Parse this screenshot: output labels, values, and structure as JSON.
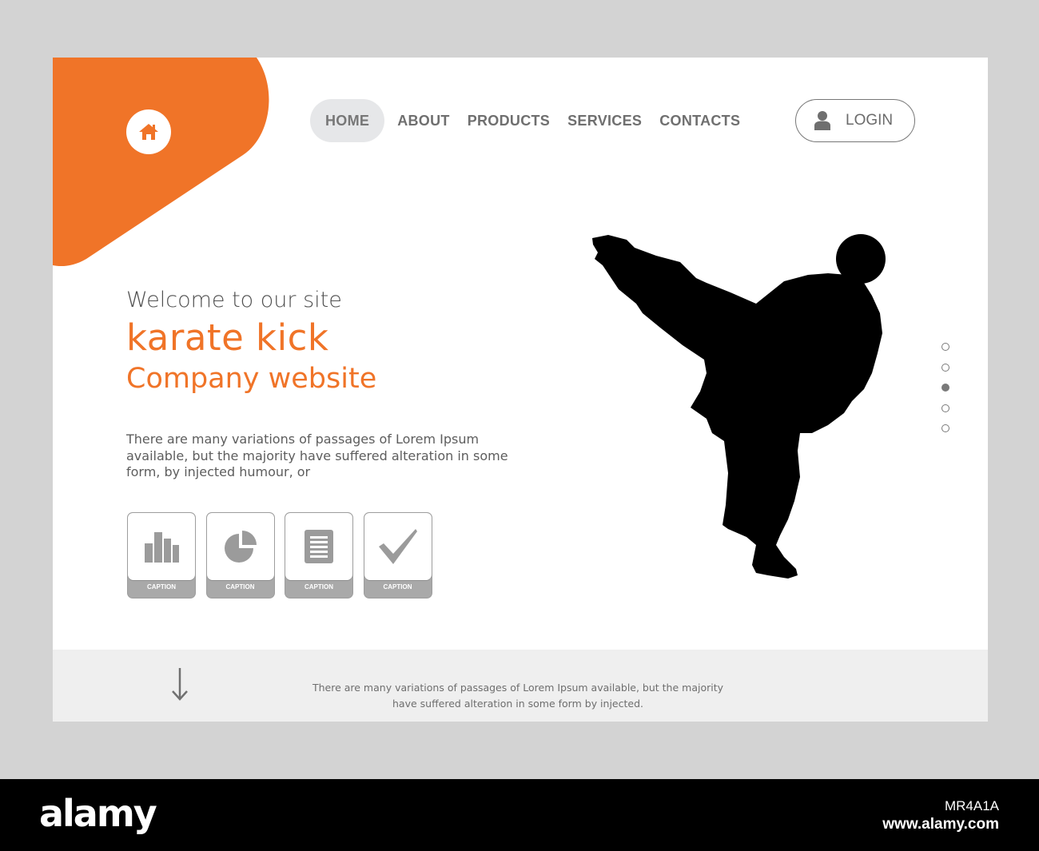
{
  "colors": {
    "accent": "#f07428",
    "text_gray": "#6f6f6f",
    "page_background": "#ffffff",
    "outer_background": "#d3d3d3",
    "footer_background": "#efefef",
    "silhouette": "#000000"
  },
  "header": {
    "home_icon": "house-icon",
    "nav": [
      {
        "label": "HOME",
        "active": true
      },
      {
        "label": "ABOUT",
        "active": false
      },
      {
        "label": "PRODUCTS",
        "active": false
      },
      {
        "label": "SERVICES",
        "active": false
      },
      {
        "label": "CONTACTS",
        "active": false
      }
    ],
    "login": {
      "label": "LOGIN",
      "icon": "user-icon"
    }
  },
  "hero": {
    "welcome": "Welcome to our site",
    "headline": "karate kick",
    "subheadline": "Company website",
    "description": "There are many variations of passages of Lorem Ipsum available, but the majority have suffered alteration in some form, by injected humour, or",
    "image": "karate-kick-silhouette"
  },
  "features": [
    {
      "icon": "bar-chart-icon",
      "caption": "CAPTION"
    },
    {
      "icon": "pie-chart-icon",
      "caption": "CAPTION"
    },
    {
      "icon": "document-icon",
      "caption": "CAPTION"
    },
    {
      "icon": "checkmark-icon",
      "caption": "CAPTION"
    }
  ],
  "slider": {
    "count": 5,
    "active_index": 2
  },
  "footer": {
    "arrow_icon": "arrow-down-icon",
    "text": "There are many variations of passages of Lorem Ipsum available, but the majority have suffered alteration in some form by injected."
  },
  "watermark_banner": {
    "logo": "alamy",
    "image_id": "MR4A1A",
    "url": "www.alamy.com"
  }
}
